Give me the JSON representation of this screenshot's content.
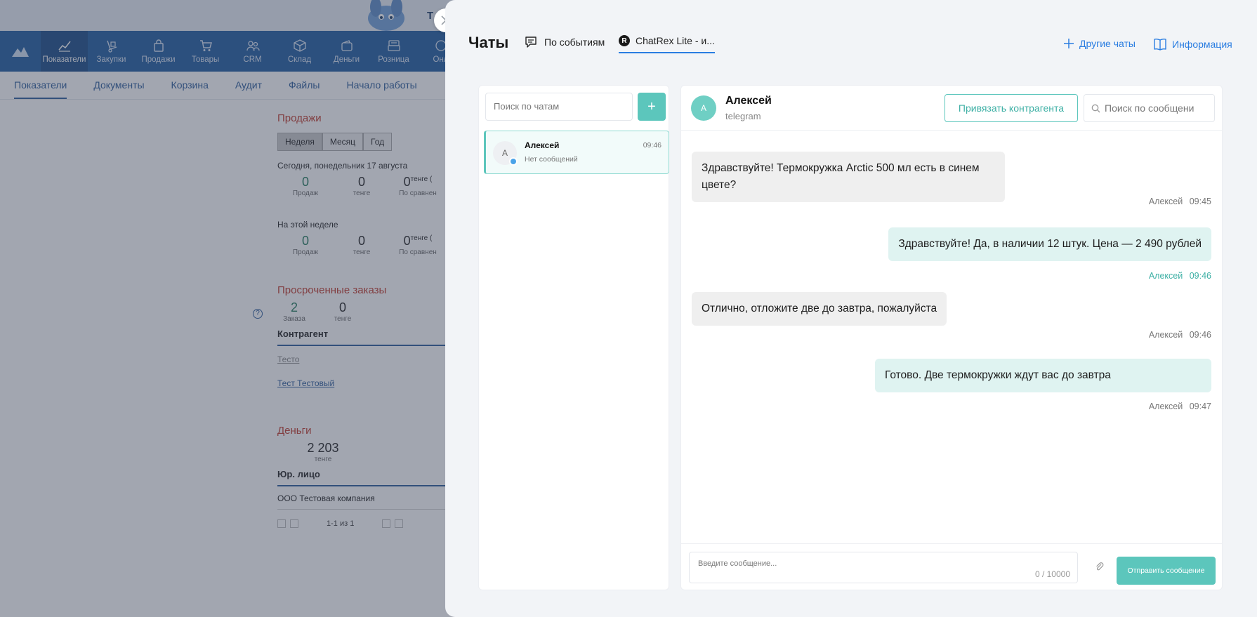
{
  "background": {
    "top_label": "Т",
    "modules": [
      {
        "label": "Показатели",
        "icon": "chart-line-icon"
      },
      {
        "label": "Закупки",
        "icon": "hand-truck-icon"
      },
      {
        "label": "Продажи",
        "icon": "shopping-bag-icon"
      },
      {
        "label": "Товары",
        "icon": "shopping-cart-icon"
      },
      {
        "label": "CRM",
        "icon": "users-icon"
      },
      {
        "label": "Склад",
        "icon": "box-icon"
      },
      {
        "label": "Деньги",
        "icon": "wallet-icon"
      },
      {
        "label": "Розница",
        "icon": "cash-register-icon"
      },
      {
        "label": "Онл",
        "icon": "online-icon"
      }
    ],
    "subtabs": [
      "Показатели",
      "Документы",
      "Корзина",
      "Аудит",
      "Файлы",
      "Начало работы"
    ],
    "sales": {
      "title": "Продажи",
      "periods": [
        "Неделя",
        "Месяц",
        "Год"
      ],
      "today": "Сегодня, понедельник 17 августа",
      "week": "На этой неделе",
      "sales_count": "0",
      "sales_label": "Продаж",
      "amount": "0",
      "amount_label": "тенге",
      "compare": "0",
      "compare_sup": "тенге (",
      "compare_label": "По сравнен"
    },
    "overdue": {
      "title": "Просроченные заказы",
      "count": "2",
      "count_label": "Заказа",
      "amount": "0",
      "amount_label": "тенге",
      "counterparty_label": "Контрагент",
      "row_muted": "Тесто",
      "row_link": "Тест Тестовый"
    },
    "money": {
      "title": "Деньги",
      "amount": "2 203",
      "amount_label": "тенге",
      "entity_label": "Юр. лицо",
      "entity": "ООО Тестовая компания",
      "pager": "1-1 из 1"
    }
  },
  "panel": {
    "title": "Чаты",
    "tabs": [
      {
        "label": "По событиям",
        "icon": "chat-bubble-icon"
      },
      {
        "label": "ChatRex Lite - и...",
        "badge": "R"
      }
    ],
    "links": [
      {
        "label": "Другие чаты",
        "icon": "plus-icon"
      },
      {
        "label": "Информация",
        "icon": "book-icon"
      }
    ],
    "chat_search_placeholder": "Поиск по чатам",
    "add_button": "+",
    "chats": [
      {
        "avatar": "А",
        "name": "Алексей",
        "preview": "Нет сообщений",
        "time": "09:46"
      }
    ],
    "conversation": {
      "avatar": "А",
      "name": "Алексей",
      "channel": "telegram",
      "bind_button": "Привязать контрагента",
      "search_placeholder": "Поиск по сообщени",
      "messages": [
        {
          "dir": "in",
          "text": "Здравствуйте! Термокружка Arctic 500 мл есть в синем цвете?",
          "author": "Алексей",
          "time": "09:45"
        },
        {
          "dir": "out",
          "text": "Здравствуйте! Да, в наличии 12 штук. Цена — 2 490 рублей",
          "author": "Алексей",
          "time": "09:46"
        },
        {
          "dir": "in",
          "text": "Отлично, отложите две до завтра, пожалуйста",
          "author": "Алексей",
          "time": "09:46"
        },
        {
          "dir": "out",
          "text": "Готово. Две термокружки ждут вас до завтра",
          "author": "Алексей",
          "time": "09:47"
        }
      ],
      "composer_placeholder": "Введите сообщение...",
      "counter": "0 / 10000",
      "send_button": "Отправить сообщение"
    }
  },
  "colors": {
    "accent_teal": "#5cc6bc",
    "link_blue": "#2a7de1",
    "module_bar": "#1e5aa0",
    "section_red": "#c0392b"
  }
}
